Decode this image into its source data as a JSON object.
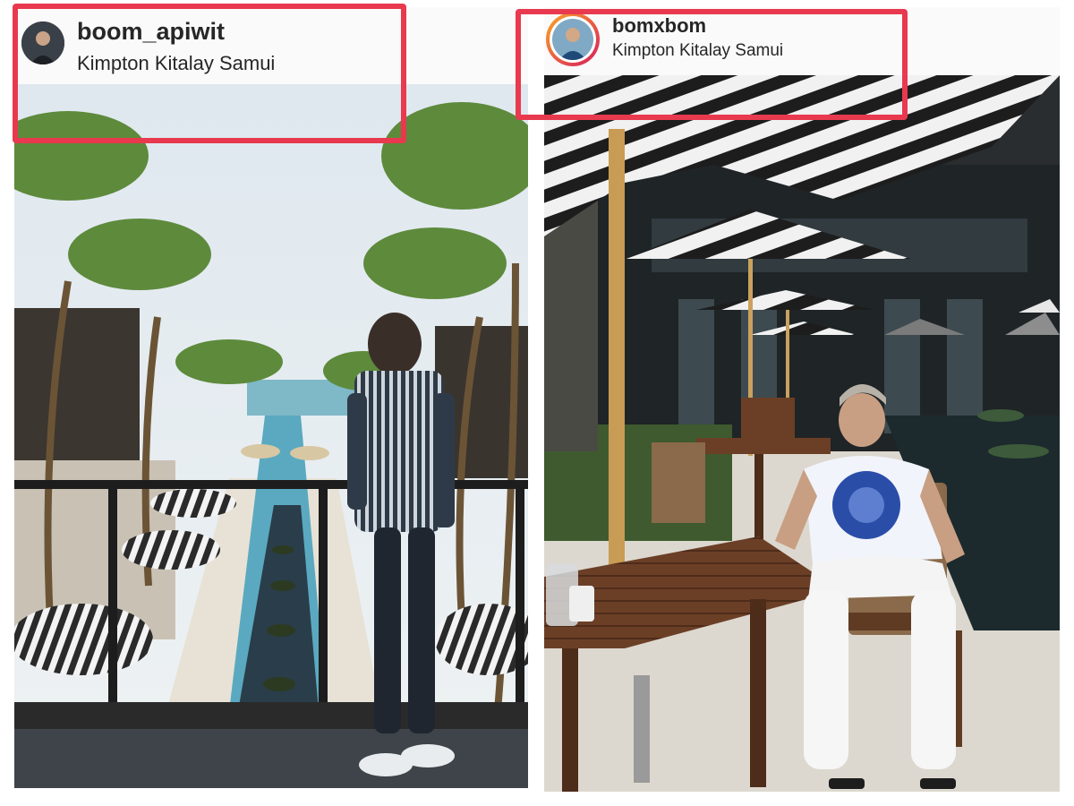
{
  "posts": [
    {
      "username": "boom_apiwit",
      "location": "Kimpton Kitalay Samui",
      "avatar_icon": "avatar-icon",
      "photo_icon": "resort-balcony-photo"
    },
    {
      "username": "bomxbom",
      "location": "Kimpton Kitalay Samui",
      "avatar_icon": "avatar-icon-story-ring",
      "photo_icon": "resort-restaurant-photo"
    }
  ],
  "colors": {
    "highlight": "#e8394f",
    "story_ring_start": "#f9a825",
    "story_ring_end": "#d81b60",
    "text": "#262626"
  }
}
